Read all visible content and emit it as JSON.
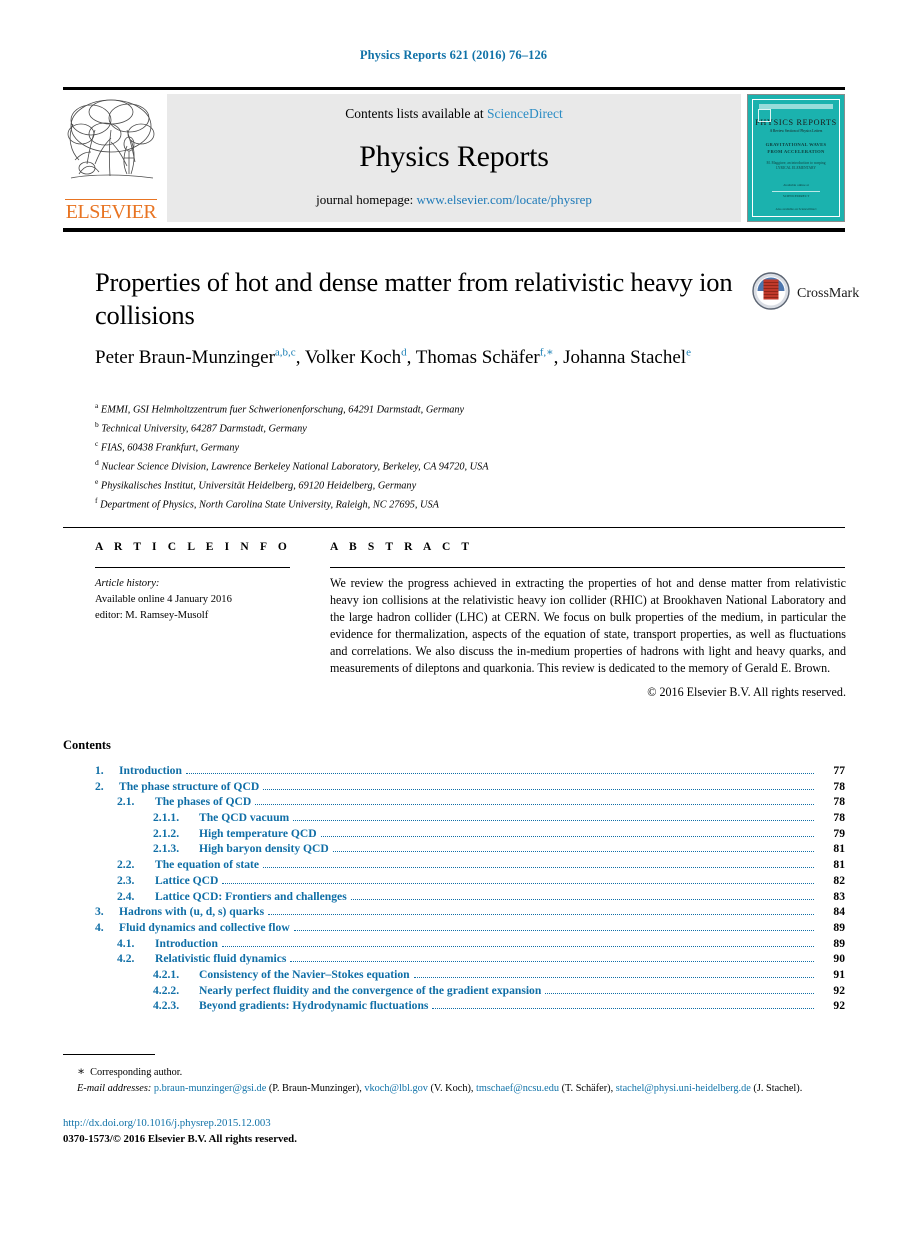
{
  "running_head": "Physics Reports 621 (2016) 76–126",
  "masthead": {
    "publisher_logo_name": "elsevier-tree-logo",
    "publisher_wordmark": "ELSEVIER",
    "contents_available_prefix": "Contents lists available at ",
    "contents_available_link": "ScienceDirect",
    "journal_title": "Physics Reports",
    "homepage_prefix": "journal homepage: ",
    "homepage_link": "www.elsevier.com/locate/physrep",
    "cover": {
      "title": "PHYSICS REPORTS",
      "subtitle": "A Review Section of Physics Letters",
      "block_line1": "GRAVITATIONAL WAVES",
      "block_line2": "FROM ACCELERATION",
      "block2_line1": "M. Maggiore, an introduction to warping",
      "block2_line2": "LYRICAL ELEMENTARY",
      "footer_line1": "Available online at",
      "footer_line2": "SCIENCEDIRECT",
      "bottom_line": "Also available on ScienceDirect"
    }
  },
  "article": {
    "title": "Properties of hot and dense matter from relativistic heavy ion collisions",
    "crossmark_label": "CrossMark",
    "authors": [
      {
        "name": "Peter Braun-Munzinger",
        "marks": "a,b,c",
        "sep": ", "
      },
      {
        "name": "Volker Koch",
        "marks": "d",
        "sep": ", "
      },
      {
        "name": "Thomas Schäfer",
        "marks": "f,∗",
        "sep": ", "
      },
      {
        "name": "Johanna Stachel",
        "marks": "e",
        "sep": ""
      }
    ],
    "affiliations": [
      {
        "mark": "a",
        "text": "EMMI, GSI Helmholtzzentrum fuer Schwerionenforschung, 64291 Darmstadt, Germany"
      },
      {
        "mark": "b",
        "text": "Technical University, 64287 Darmstadt, Germany"
      },
      {
        "mark": "c",
        "text": "FIAS, 60438 Frankfurt, Germany"
      },
      {
        "mark": "d",
        "text": "Nuclear Science Division, Lawrence Berkeley National Laboratory, Berkeley, CA 94720, USA"
      },
      {
        "mark": "e",
        "text": "Physikalisches Institut, Universität Heidelberg, 69120 Heidelberg, Germany"
      },
      {
        "mark": "f",
        "text": "Department of Physics, North Carolina State University, Raleigh, NC 27695, USA"
      }
    ]
  },
  "article_info": {
    "heading": "A R T I C L E   I N F O",
    "history_label": "Article history:",
    "available_online": "Available online 4 January 2016",
    "editor": "editor: M. Ramsey-Musolf"
  },
  "abstract": {
    "heading": "A B S T R A C T",
    "text": "We review the progress achieved in extracting the properties of hot and dense matter from relativistic heavy ion collisions at the relativistic heavy ion collider (RHIC) at Brookhaven National Laboratory and the large hadron collider (LHC) at CERN. We focus on bulk properties of the medium, in particular the evidence for thermalization, aspects of the equation of state, transport properties, as well as fluctuations and correlations. We also discuss the in-medium properties of hadrons with light and heavy quarks, and measurements of dileptons and quarkonia. This review is dedicated to the memory of Gerald E. Brown.",
    "copyright": "© 2016 Elsevier B.V. All rights reserved."
  },
  "contents": {
    "heading": "Contents",
    "entries": [
      {
        "level": 1,
        "num": "1.",
        "label": "Introduction",
        "page": "77"
      },
      {
        "level": 1,
        "num": "2.",
        "label": "The phase structure of QCD",
        "page": "78"
      },
      {
        "level": 2,
        "num": "2.1.",
        "label": "The phases of QCD",
        "page": "78"
      },
      {
        "level": 3,
        "num": "2.1.1.",
        "label": "The QCD vacuum",
        "page": "78"
      },
      {
        "level": 3,
        "num": "2.1.2.",
        "label": "High temperature QCD",
        "page": "79"
      },
      {
        "level": 3,
        "num": "2.1.3.",
        "label": "High baryon density QCD",
        "page": "81"
      },
      {
        "level": 2,
        "num": "2.2.",
        "label": "The equation of state",
        "page": "81"
      },
      {
        "level": 2,
        "num": "2.3.",
        "label": "Lattice QCD",
        "page": "82"
      },
      {
        "level": 2,
        "num": "2.4.",
        "label": "Lattice QCD: Frontiers and challenges",
        "page": "83"
      },
      {
        "level": 1,
        "num": "3.",
        "label": "Hadrons with (u, d, s) quarks",
        "page": "84"
      },
      {
        "level": 1,
        "num": "4.",
        "label": "Fluid dynamics and collective flow",
        "page": "89"
      },
      {
        "level": 2,
        "num": "4.1.",
        "label": "Introduction",
        "page": "89"
      },
      {
        "level": 2,
        "num": "4.2.",
        "label": "Relativistic fluid dynamics",
        "page": "90"
      },
      {
        "level": 3,
        "num": "4.2.1.",
        "label": "Consistency of the Navier–Stokes equation",
        "page": "91"
      },
      {
        "level": 3,
        "num": "4.2.2.",
        "label": "Nearly perfect fluidity and the convergence of the gradient expansion",
        "page": "92"
      },
      {
        "level": 3,
        "num": "4.2.3.",
        "label": "Beyond gradients: Hydrodynamic fluctuations",
        "page": "92"
      }
    ]
  },
  "footnotes": {
    "star": "∗",
    "corresponding": "Corresponding author.",
    "emails_label": "E-mail addresses:",
    "emails": [
      {
        "address": "p.braun-munzinger@gsi.de",
        "who": " (P. Braun-Munzinger), "
      },
      {
        "address": "vkoch@lbl.gov",
        "who": " (V. Koch), "
      },
      {
        "address": "tmschaef@ncsu.edu",
        "who": " (T. Schäfer), "
      },
      {
        "address": "stachel@physi.uni-heidelberg.de",
        "who": " (J. Stachel)."
      }
    ],
    "doi": "http://dx.doi.org/10.1016/j.physrep.2015.12.003",
    "issn": "0370-1573/© 2016 Elsevier B.V. All rights reserved."
  },
  "colors": {
    "link_blue": "#1072a8",
    "toc_blue": "#0f6ea6",
    "sciencedirect_blue": "#2b8cc4",
    "elsevier_orange": "#e87422",
    "cover_teal": "#1bb2ae"
  }
}
